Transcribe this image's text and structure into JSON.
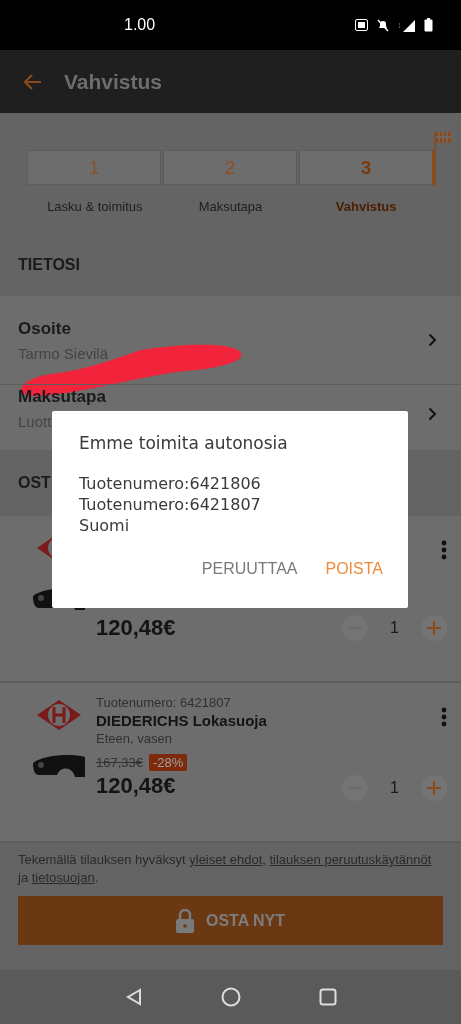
{
  "status_bar": {
    "time": "1.00"
  },
  "app_bar": {
    "title": "Vahvistus"
  },
  "steps": [
    {
      "number": "1",
      "label": "Lasku & toimitus",
      "selected": false
    },
    {
      "number": "2",
      "label": "Maksutapa",
      "selected": false
    },
    {
      "number": "3",
      "label": "Vahvistus",
      "selected": true
    }
  ],
  "section_title": "TIETOSI",
  "info_rows": [
    {
      "title": "Osoite",
      "value": "Tarmo Sievilä",
      "redacted": true
    },
    {
      "title": "Maksutapa",
      "value": "Luott",
      "redacted": false
    }
  ],
  "order_section_title": "OST",
  "products": [
    {
      "price": "120,48€",
      "quantity": "1"
    },
    {
      "number": "Tuotenumero: 6421807",
      "name": "DIEDERICHS Lokasuoja",
      "variant": "Eteen, vasen",
      "old_price": "167,33€",
      "discount": "-28%",
      "price": "120,48€",
      "quantity": "1"
    }
  ],
  "terms": [
    {
      "text": "Tekemällä tilauksen hyväksyt ",
      "kind": "text"
    },
    {
      "text": "yleiset ehdot",
      "kind": "link"
    },
    {
      "text": ", ",
      "kind": "text"
    },
    {
      "text": "tilauksen peruutuskäytännöt",
      "kind": "link"
    },
    {
      "text": " ja ",
      "kind": "text"
    },
    {
      "text": "tietosuojan",
      "kind": "link"
    },
    {
      "text": ".",
      "kind": "text"
    }
  ],
  "buy_button": {
    "label": "OSTA NYT"
  },
  "dialog": {
    "title": "Emme toimita autonosia",
    "lines": [
      "Tuotenumero:6421806",
      "Tuotenumero:6421807",
      "Suomi"
    ],
    "buttons": [
      {
        "label": "PERUUTTAA",
        "kind": "cancel"
      },
      {
        "label": "POISTA",
        "kind": "confirm"
      }
    ]
  }
}
